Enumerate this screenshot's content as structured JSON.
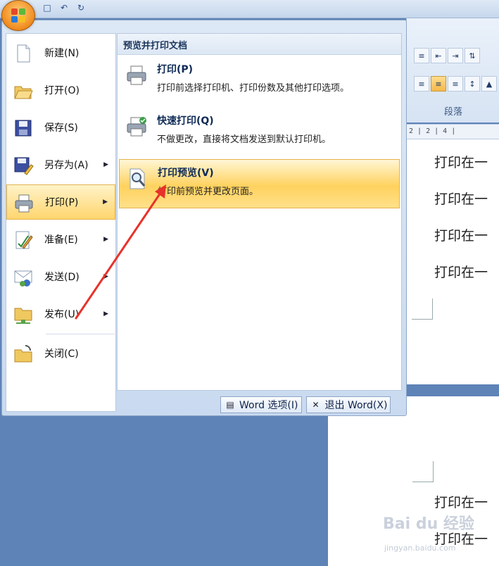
{
  "app": {
    "qat": [
      "save-icon",
      "undo-icon",
      "redo-icon"
    ]
  },
  "ribbon": {
    "group_label": "段落"
  },
  "ruler": {
    "text": "2 | 2 | 4 |"
  },
  "document": {
    "lines": [
      "打印在一",
      "打印在一",
      "打印在一",
      "打印在一",
      "打印在一",
      "打印在一"
    ]
  },
  "menu": {
    "left": [
      {
        "label": "新建(N)",
        "icon": "new-doc-icon",
        "arrow": false
      },
      {
        "label": "打开(O)",
        "icon": "open-folder-icon",
        "arrow": false
      },
      {
        "label": "保存(S)",
        "icon": "save-icon",
        "arrow": false
      },
      {
        "label": "另存为(A)",
        "icon": "save-as-icon",
        "arrow": true
      },
      {
        "label": "打印(P)",
        "icon": "printer-icon",
        "arrow": true,
        "active": true
      },
      {
        "label": "准备(E)",
        "icon": "prepare-icon",
        "arrow": true
      },
      {
        "label": "发送(D)",
        "icon": "send-icon",
        "arrow": true
      },
      {
        "label": "发布(U)",
        "icon": "publish-icon",
        "arrow": true
      },
      {
        "label": "关闭(C)",
        "icon": "close-folder-icon",
        "arrow": false
      }
    ],
    "submenu": {
      "header": "预览并打印文档",
      "items": [
        {
          "title": "打印(P)",
          "desc": "打印前选择打印机、打印份数及其他打印选项。",
          "icon": "printer-icon"
        },
        {
          "title": "快速打印(Q)",
          "desc": "不做更改，直接将文档发送到默认打印机。",
          "icon": "quick-print-icon"
        },
        {
          "title": "打印预览(V)",
          "desc": "打印前预览并更改页面。",
          "icon": "print-preview-icon",
          "active": true
        }
      ]
    },
    "footer": {
      "options_label": "Word 选项(I)",
      "exit_label": "退出 Word(X)"
    }
  },
  "watermark": {
    "text": "Bai du 经验",
    "sub": "jingyan.baidu.com"
  }
}
